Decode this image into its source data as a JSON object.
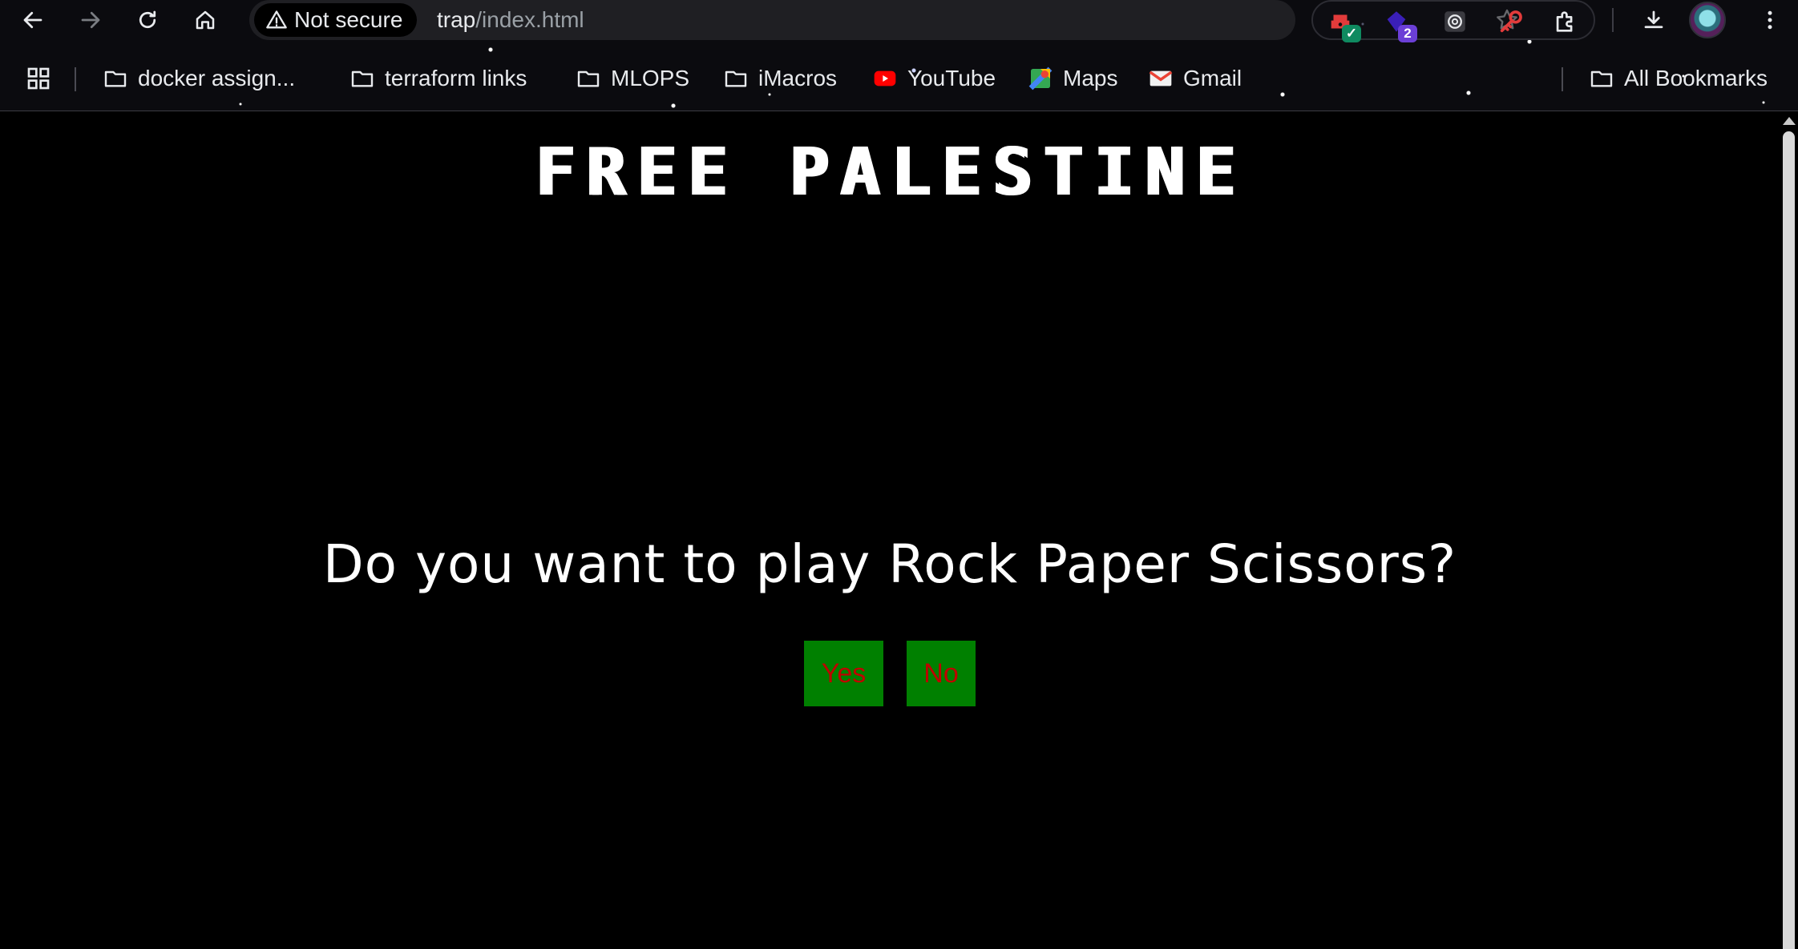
{
  "browser": {
    "security_label": "Not secure",
    "url_host": "trap",
    "url_path": "/index.html",
    "extensions": [
      {
        "name": "password-manager-extension",
        "badge": ""
      },
      {
        "name": "purple-extension",
        "badge": "2"
      },
      {
        "name": "chatgpt-extension",
        "badge": ""
      },
      {
        "name": "key-extension",
        "badge": ""
      }
    ]
  },
  "bookmarks": {
    "items": [
      {
        "label": "docker assign...",
        "icon": "folder-icon"
      },
      {
        "label": "terraform links",
        "icon": "folder-icon"
      },
      {
        "label": "MLOPS",
        "icon": "folder-icon"
      },
      {
        "label": "iMacros",
        "icon": "folder-icon"
      },
      {
        "label": "YouTube",
        "icon": "youtube-icon"
      },
      {
        "label": "Maps",
        "icon": "maps-icon"
      },
      {
        "label": "Gmail",
        "icon": "gmail-icon"
      }
    ],
    "all_bookmarks_label": "All Bookmarks"
  },
  "page": {
    "title": "FREE PALESTINE",
    "question": "Do you want to play Rock Paper Scissors?",
    "yes_label": "Yes",
    "no_label": "No"
  },
  "colors": {
    "page_background": "#000000",
    "button_background": "#008000",
    "button_text": "#c00000",
    "text": "#ffffff"
  }
}
